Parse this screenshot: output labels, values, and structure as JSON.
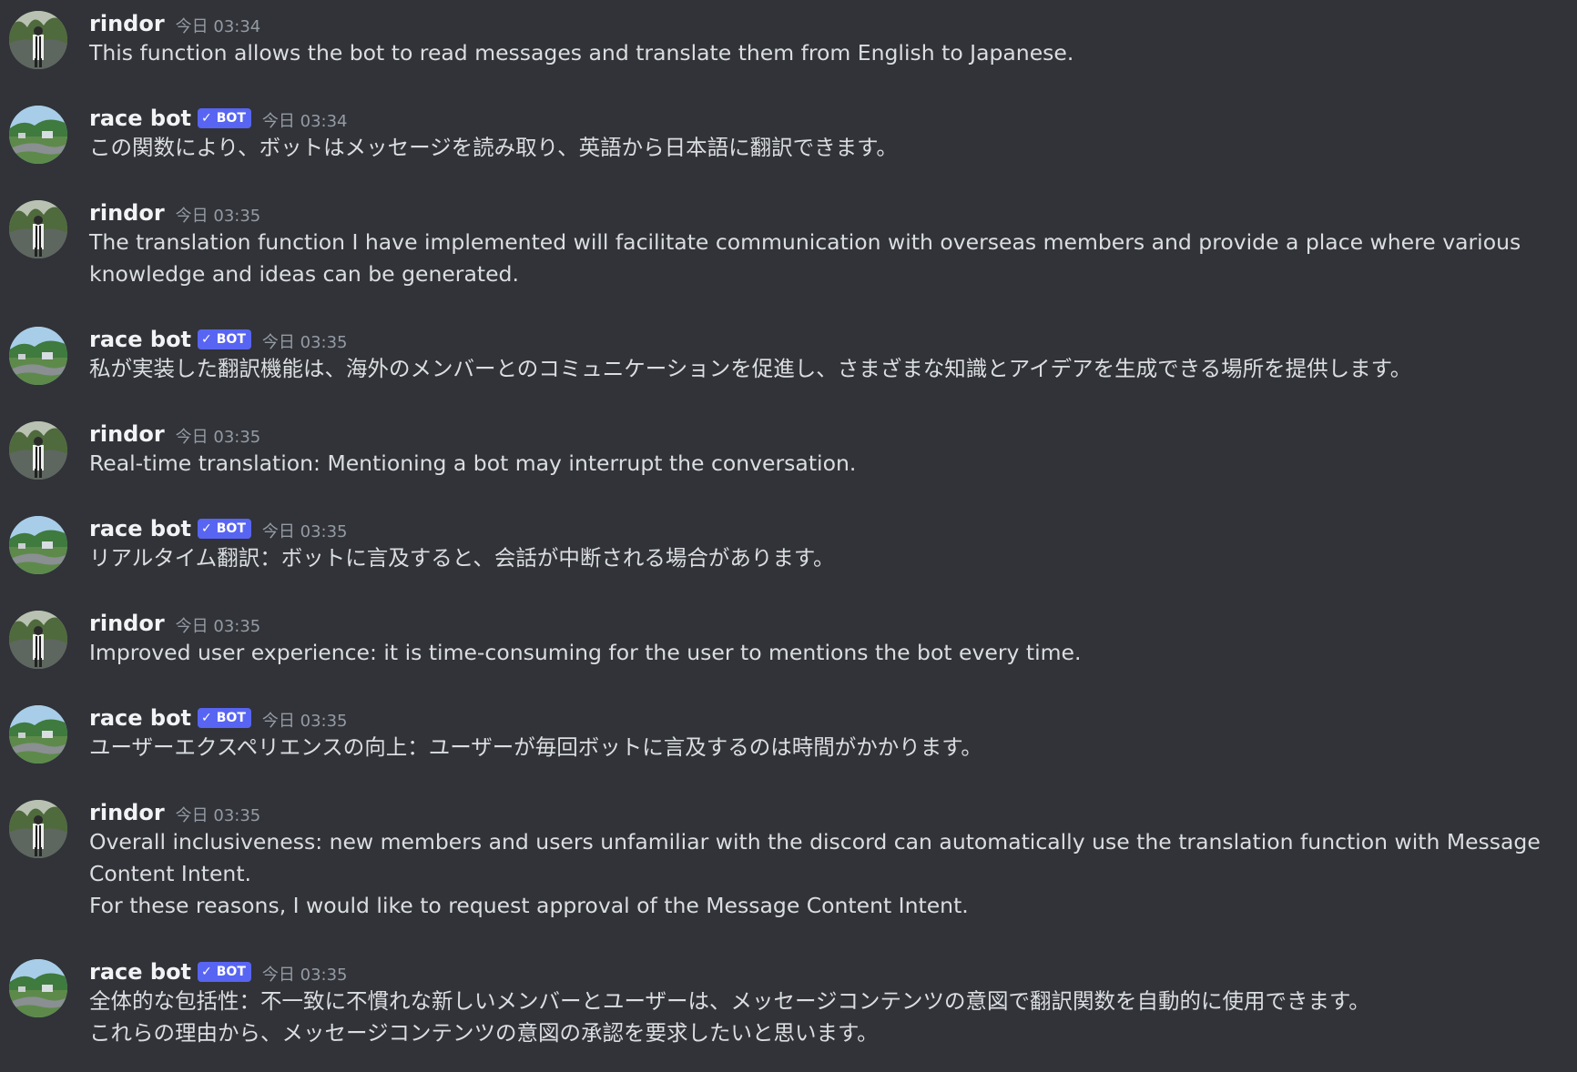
{
  "colors": {
    "background": "#313338",
    "username": "#f2f3f5",
    "text": "#dbdee1",
    "timestamp": "#949ba4",
    "bot_badge": "#5865f2"
  },
  "bot_badge": {
    "check_icon": "check-icon",
    "label": "BOT"
  },
  "messages": [
    {
      "author": "rindor",
      "timestamp": "今日 03:34",
      "lines": [
        "This function allows the bot to read messages and translate them from English to Japanese."
      ]
    },
    {
      "author": "race bot",
      "timestamp": "今日 03:34",
      "lines": [
        "この関数により、ボットはメッセージを読み取り、英語から日本語に翻訳できます。"
      ]
    },
    {
      "author": "rindor",
      "timestamp": "今日 03:35",
      "lines": [
        "The translation function I have implemented will facilitate communication with overseas members and provide a place where various knowledge and ideas can be generated."
      ]
    },
    {
      "author": "race bot",
      "timestamp": "今日 03:35",
      "lines": [
        "私が実装した翻訳機能は、海外のメンバーとのコミュニケーションを促進し、さまざまな知識とアイデアを生成できる場所を提供します。"
      ]
    },
    {
      "author": "rindor",
      "timestamp": "今日 03:35",
      "lines": [
        "Real-time translation: Mentioning a bot may interrupt the conversation."
      ]
    },
    {
      "author": "race bot",
      "timestamp": "今日 03:35",
      "lines": [
        "リアルタイム翻訳：ボットに言及すると、会話が中断される場合があります。"
      ]
    },
    {
      "author": "rindor",
      "timestamp": "今日 03:35",
      "lines": [
        "Improved user experience: it is time-consuming for the user to mentions the bot every time."
      ]
    },
    {
      "author": "race bot",
      "timestamp": "今日 03:35",
      "lines": [
        "ユーザーエクスペリエンスの向上：ユーザーが毎回ボットに言及するのは時間がかかります。"
      ]
    },
    {
      "author": "rindor",
      "timestamp": "今日 03:35",
      "lines": [
        "Overall inclusiveness: new members and users unfamiliar with the discord can automatically use the translation function with Message Content Intent.",
        "For these reasons, I would like to request approval of the Message Content Intent."
      ]
    },
    {
      "author": "race bot",
      "timestamp": "今日 03:35",
      "lines": [
        "全体的な包括性：不一致に不慣れな新しいメンバーとユーザーは、メッセージコンテンツの意図で翻訳関数を自動的に使用できます。",
        "これらの理由から、メッセージコンテンツの意図の承認を要求したいと思います。"
      ]
    }
  ]
}
